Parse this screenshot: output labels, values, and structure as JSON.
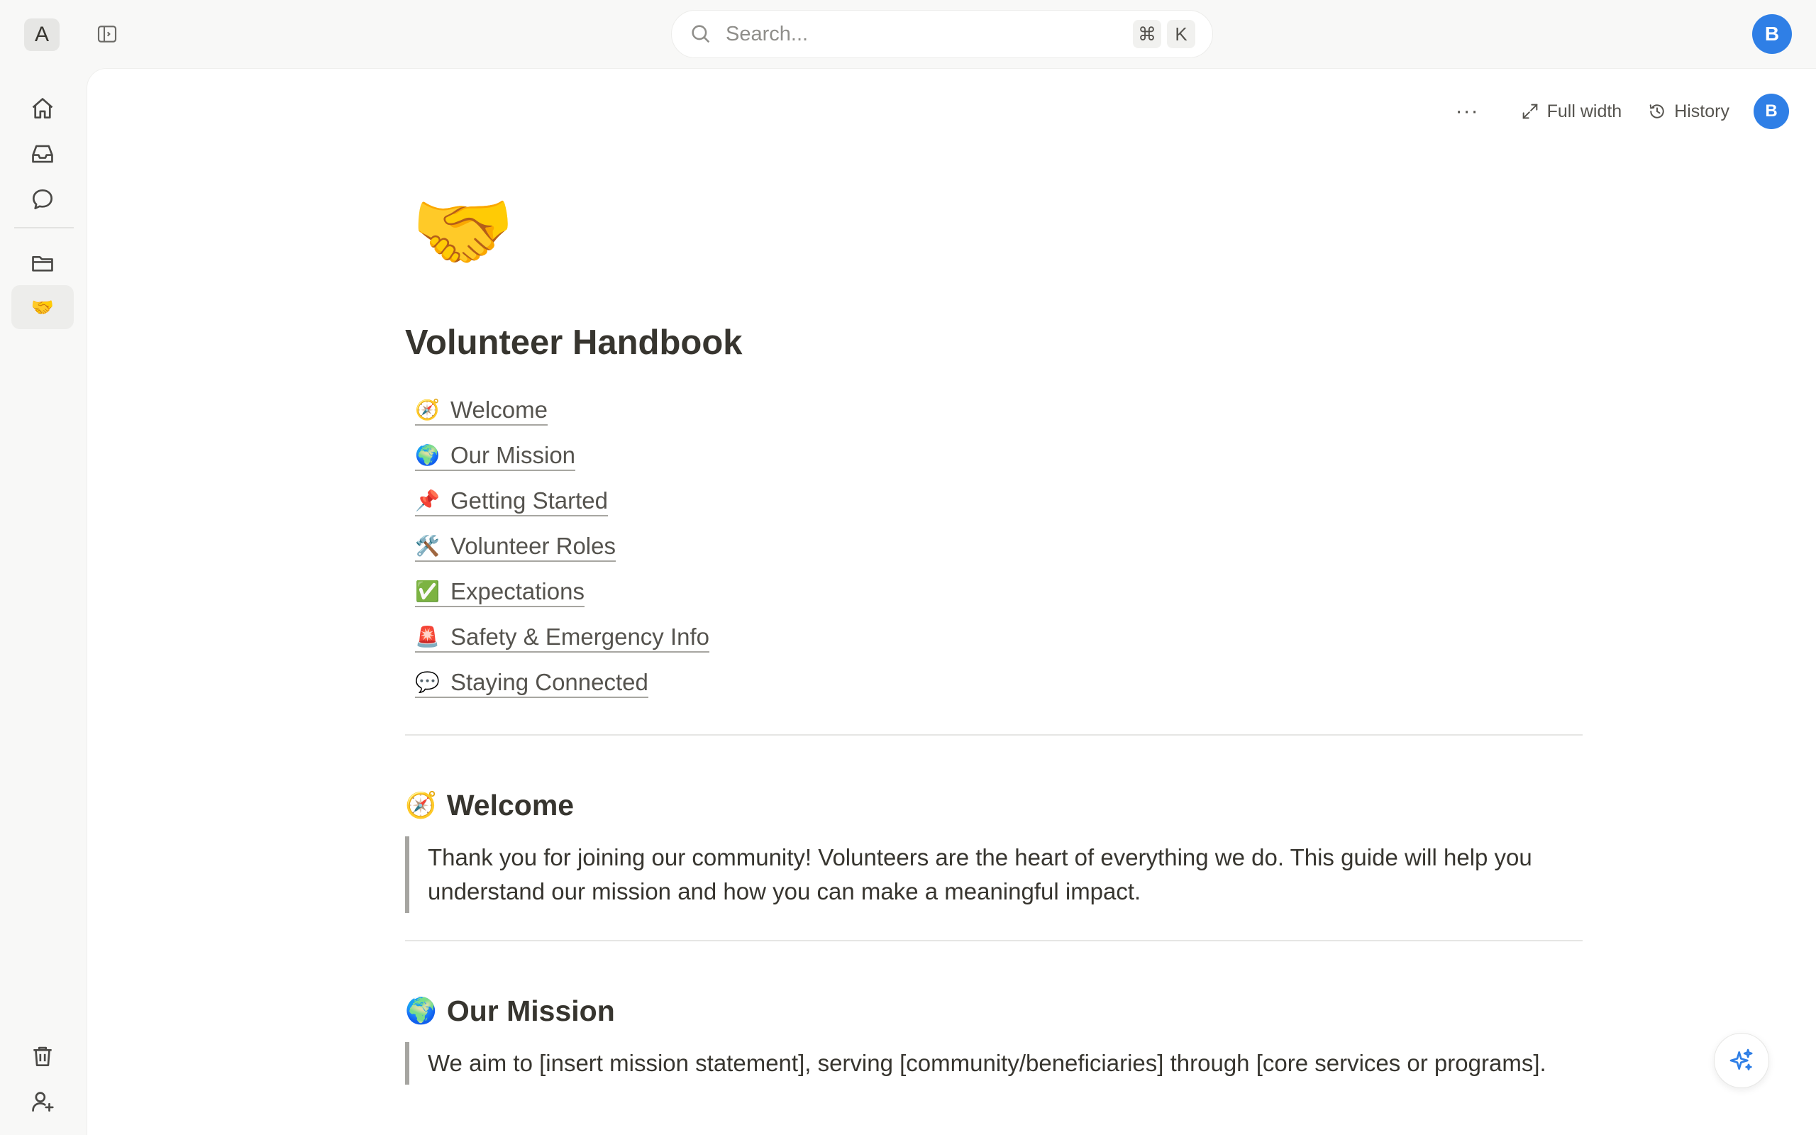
{
  "workspace": {
    "initial": "A"
  },
  "search": {
    "placeholder": "Search...",
    "shortcut_cmd": "⌘",
    "shortcut_key": "K"
  },
  "user": {
    "initial": "B"
  },
  "colors": {
    "accent": "#2f7fe6",
    "ai_accent": "#2f7fe6"
  },
  "rail": {
    "items": [
      {
        "name": "home",
        "icon": "home-icon"
      },
      {
        "name": "inbox",
        "icon": "inbox-icon"
      },
      {
        "name": "chat",
        "icon": "chat-icon"
      },
      {
        "name": "files",
        "icon": "folder-icon"
      },
      {
        "name": "current-page",
        "icon": "🤝"
      }
    ],
    "bottom": [
      {
        "name": "trash",
        "icon": "trash-icon"
      },
      {
        "name": "invite",
        "icon": "add-user-icon"
      }
    ]
  },
  "page_actions": {
    "more": "···",
    "full_width": "Full width",
    "history": "History"
  },
  "page": {
    "icon": "🤝",
    "title": "Volunteer Handbook",
    "toc": [
      {
        "emoji": "🧭",
        "label": "Welcome"
      },
      {
        "emoji": "🌍",
        "label": "Our Mission"
      },
      {
        "emoji": "📌",
        "label": "Getting Started"
      },
      {
        "emoji": "🛠️",
        "label": "Volunteer Roles"
      },
      {
        "emoji": "✅",
        "label": "Expectations"
      },
      {
        "emoji": "🚨",
        "label": "Safety & Emergency Info"
      },
      {
        "emoji": "💬",
        "label": "Staying Connected"
      }
    ],
    "sections": [
      {
        "emoji": "🧭",
        "heading": "Welcome",
        "quote": "Thank you for joining our community! Volunteers are the heart of everything we do. This guide will help you understand our mission and how you can make a meaningful impact."
      },
      {
        "emoji": "🌍",
        "heading": "Our Mission",
        "quote": "We aim to [insert mission statement], serving [community/beneficiaries] through [core services or programs]."
      }
    ]
  }
}
